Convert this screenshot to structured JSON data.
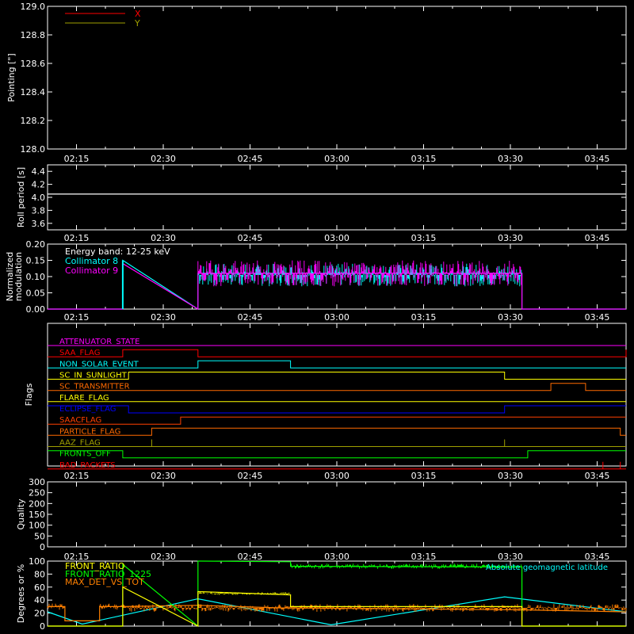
{
  "time_ticks": [
    "02:15",
    "02:30",
    "02:45",
    "03:00",
    "03:15",
    "03:30",
    "03:45"
  ],
  "colors": {
    "background": "#000000",
    "axes": "#ffffff",
    "red": "#ff0000",
    "yellow": "#ffff00",
    "cyan": "#00ffff",
    "magenta": "#ff00ff",
    "green": "#00ff00",
    "orange": "#ff8000",
    "blue": "#0000ff",
    "olive": "#a0a000",
    "orange_red": "#ff4000",
    "dark_orange": "#ff6a00"
  },
  "chart_data": [
    {
      "type": "line",
      "ylabel": "Pointing [\"]",
      "ylim": [
        128.0,
        129.0
      ],
      "yticks": [
        "128.0",
        "128.2",
        "128.4",
        "128.6",
        "128.8",
        "129.0"
      ],
      "legend": "top-left",
      "series": [
        {
          "name": "X",
          "color": "#ff0000",
          "values": []
        },
        {
          "name": "Y",
          "color": "#a0a000",
          "values": []
        }
      ]
    },
    {
      "type": "line",
      "ylabel": "Roll period [s]",
      "ylim": [
        3.5,
        4.5
      ],
      "yticks": [
        "3.6",
        "3.8",
        "4.0",
        "4.2",
        "4.4"
      ],
      "series": [
        {
          "color": "#ffffff",
          "x": [
            "02:10",
            "03:50"
          ],
          "values": [
            4.05,
            4.05
          ]
        }
      ]
    },
    {
      "type": "line",
      "ylabel": "Normalized modulation",
      "ylim": [
        0.0,
        0.2
      ],
      "yticks": [
        "0.00",
        "0.05",
        "0.10",
        "0.15",
        "0.20"
      ],
      "legend": "top-left",
      "annotation": "Energy band: 12-25 keV",
      "series": [
        {
          "name": "Collimator 8",
          "color": "#00ffff",
          "x": [
            "02:10",
            "02:23",
            "02:23",
            "02:36",
            "02:36",
            "03:32",
            "03:32",
            "03:50"
          ],
          "values": [
            0.0,
            0.0,
            0.15,
            0.0,
            0.11,
            0.11,
            0.0,
            0.0
          ]
        },
        {
          "name": "Collimator 9",
          "color": "#ff00ff",
          "x": [
            "02:10",
            "02:23",
            "02:23",
            "02:36",
            "02:36",
            "03:32",
            "03:32",
            "03:50"
          ],
          "values": [
            0.0,
            0.0,
            0.14,
            0.0,
            0.11,
            0.11,
            0.0,
            0.0
          ]
        }
      ]
    },
    {
      "type": "line",
      "ylabel": "Flags",
      "flags": [
        {
          "name": "ATTENUATOR_STATE",
          "color": "#ff00ff",
          "steps": [
            [
              "02:10",
              0
            ]
          ]
        },
        {
          "name": "SAA_FLAG",
          "color": "#ff0000",
          "steps": [
            [
              "02:10",
              0
            ],
            [
              "02:23",
              1
            ],
            [
              "02:36",
              0
            ],
            [
              "03:50",
              1
            ]
          ]
        },
        {
          "name": "NON_SOLAR_EVENT",
          "color": "#00ffff",
          "steps": [
            [
              "02:10",
              0
            ],
            [
              "02:36",
              1
            ],
            [
              "02:52",
              0
            ]
          ]
        },
        {
          "name": "SC_IN_SUNLIGHT",
          "color": "#ffff00",
          "steps": [
            [
              "02:10",
              0
            ],
            [
              "02:24",
              1
            ],
            [
              "03:29",
              0
            ]
          ]
        },
        {
          "name": "SC_TRANSMITTER",
          "color": "#ff6a00",
          "steps": [
            [
              "02:10",
              0
            ],
            [
              "03:37",
              1
            ],
            [
              "03:43",
              0
            ]
          ]
        },
        {
          "name": "FLARE_FLAG",
          "color": "#ffff00",
          "steps": [
            [
              "02:10",
              0
            ]
          ]
        },
        {
          "name": "ECLIPSE_FLAG",
          "color": "#0000ff",
          "steps": [
            [
              "02:10",
              1
            ],
            [
              "02:24",
              0
            ],
            [
              "03:29",
              1
            ]
          ]
        },
        {
          "name": "SAACFLAG",
          "color": "#ff4000",
          "steps": [
            [
              "02:10",
              0
            ],
            [
              "02:33",
              1
            ],
            [
              "03:50",
              1
            ]
          ]
        },
        {
          "name": "PARTICLE_FLAG",
          "color": "#ff6a00",
          "steps": [
            [
              "02:10",
              0
            ],
            [
              "02:28",
              1
            ],
            [
              "03:49",
              0
            ]
          ]
        },
        {
          "name": "AAZ_FLAG",
          "color": "#a0a000",
          "steps": [
            [
              "02:10",
              0
            ],
            [
              "02:28",
              1
            ],
            [
              "02:28",
              0
            ],
            [
              "03:29",
              1
            ],
            [
              "03:29",
              0
            ]
          ]
        },
        {
          "name": "FRONTS_OFF",
          "color": "#00ff00",
          "steps": [
            [
              "02:10",
              1
            ],
            [
              "02:23",
              0
            ],
            [
              "03:33",
              1
            ]
          ]
        },
        {
          "name": "BAD_PACKETS",
          "color": "#ff0000",
          "steps": [
            [
              "02:10",
              0
            ],
            [
              "03:46",
              1
            ],
            [
              "03:46",
              0
            ],
            [
              "03:49",
              1
            ],
            [
              "03:49",
              0
            ]
          ]
        }
      ]
    },
    {
      "type": "line",
      "ylabel": "Quality",
      "ylim": [
        0,
        300
      ],
      "yticks": [
        "0",
        "50",
        "100",
        "150",
        "200",
        "250",
        "300"
      ],
      "series": []
    },
    {
      "type": "line",
      "ylabel": "Degrees or %",
      "ylim": [
        0,
        100
      ],
      "yticks": [
        "0",
        "20",
        "40",
        "60",
        "80",
        "100"
      ],
      "legend": "top-left",
      "series": [
        {
          "name": "FRONT_RATIO",
          "color": "#ffff00",
          "x": [
            "02:10",
            "02:23",
            "02:23",
            "02:36",
            "02:36",
            "02:52",
            "02:52",
            "03:32",
            "03:32",
            "03:50"
          ],
          "values": [
            0,
            0,
            60,
            0,
            53,
            48,
            30,
            30,
            0,
            0
          ]
        },
        {
          "name": "FRONT_RATIO_1225",
          "color": "#00ff00",
          "x": [
            "02:10",
            "02:23",
            "02:23",
            "02:36",
            "02:36",
            "02:52",
            "02:52",
            "03:32",
            "03:32",
            "03:50"
          ],
          "values": [
            0,
            0,
            95,
            0,
            100,
            99,
            92,
            91,
            0,
            0
          ]
        },
        {
          "name": "MAX_DET_VS_TOT",
          "color": "#ff8000",
          "x": [
            "02:10",
            "02:13",
            "02:13",
            "02:16",
            "02:19",
            "02:19",
            "02:23",
            "02:36",
            "02:50",
            "03:32",
            "03:50"
          ],
          "values": [
            30,
            30,
            8,
            8,
            8,
            30,
            30,
            32,
            28,
            25,
            22
          ]
        },
        {
          "name": "Absolute geomagnetic latitude",
          "color": "#00ffff",
          "x": [
            "02:10",
            "02:16",
            "02:36",
            "02:59",
            "03:29",
            "03:50"
          ],
          "values": [
            22,
            3,
            42,
            2,
            45,
            22
          ]
        }
      ]
    }
  ]
}
